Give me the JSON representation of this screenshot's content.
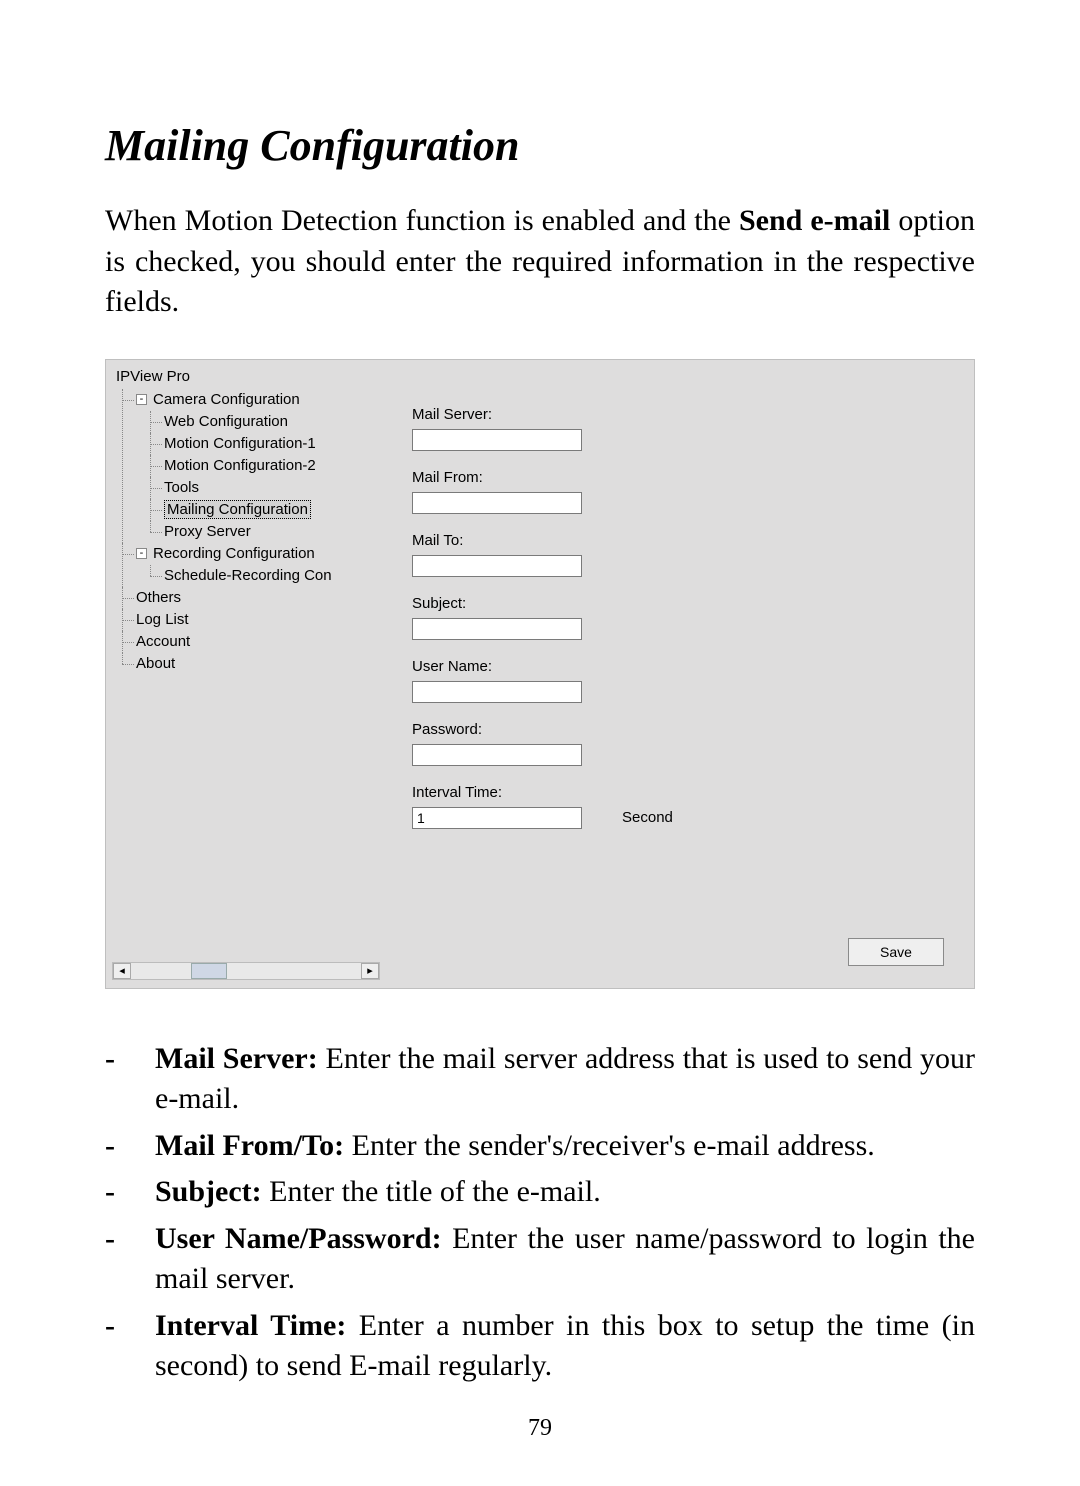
{
  "title": "Mailing Configuration",
  "intro": {
    "pre": "When Motion Detection function is enabled and the ",
    "bold": "Send e-mail",
    "post": " option is checked, you should enter the required information in the respective fields."
  },
  "screenshot": {
    "app_title": "IPView Pro",
    "tree": {
      "root": "Camera Configuration",
      "root_children": [
        "Web Configuration",
        "Motion Configuration-1",
        "Motion Configuration-2",
        "Tools",
        "Mailing Configuration",
        "Proxy Server"
      ],
      "selected": "Mailing Configuration",
      "recording": "Recording Configuration",
      "recording_children": [
        "Schedule-Recording Con"
      ],
      "rest": [
        "Others",
        "Log List",
        "Account",
        "About"
      ]
    },
    "fields": {
      "mail_server": {
        "label": "Mail Server:",
        "value": ""
      },
      "mail_from": {
        "label": "Mail From:",
        "value": ""
      },
      "mail_to": {
        "label": "Mail To:",
        "value": ""
      },
      "subject": {
        "label": "Subject:",
        "value": ""
      },
      "user_name": {
        "label": "User Name:",
        "value": ""
      },
      "password": {
        "label": "Password:",
        "value": ""
      },
      "interval": {
        "label": "Interval Time:",
        "value": "1",
        "unit": "Second"
      }
    },
    "save_label": "Save",
    "scroll_left": "◂",
    "scroll_right": "▸"
  },
  "bullets": [
    {
      "term": "Mail Server:",
      "desc": " Enter the mail server address that is used to send your e-mail."
    },
    {
      "term": "Mail From/To:",
      "desc": " Enter the sender's/receiver's e-mail address."
    },
    {
      "term": "Subject:",
      "desc": " Enter the title of the e-mail."
    },
    {
      "term": "User Name/Password:",
      "desc": " Enter the user name/password to login the mail server."
    },
    {
      "term": "Interval Time:",
      "desc": " Enter a number in this box to setup the time (in second) to send E-mail regularly."
    }
  ],
  "dash": "-",
  "page_number": "79"
}
